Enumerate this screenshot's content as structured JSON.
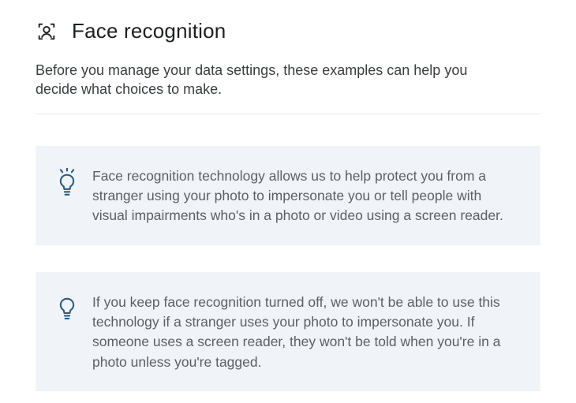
{
  "header": {
    "title": "Face recognition"
  },
  "intro": "Before you manage your data settings, these examples can help you decide what choices to make.",
  "cards": [
    {
      "text": "Face recognition technology allows us to help protect you from a stranger using your photo to impersonate you or tell people with visual impairments who's in a photo or video using a screen reader."
    },
    {
      "text": "If you keep face recognition turned off, we won't be able to use this technology if a stranger uses your photo to impersonate you. If someone uses a screen reader, they won't be told when you're in a photo unless you're tagged."
    }
  ]
}
